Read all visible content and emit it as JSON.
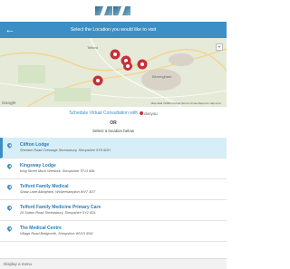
{
  "header": {
    "logo_icon": "four-triangle-logo"
  },
  "title_bar": {
    "back_icon": "arrow-left-icon",
    "title": "Select the Location you would like to visit"
  },
  "map": {
    "labels": [
      "Telford",
      "Birmingham",
      "Google"
    ],
    "zoom_label": "+",
    "footer": "Map data ©2023 Google  Terms of Use  Report a map error"
  },
  "virtual": {
    "link": "Schedule Virtual Consultation with",
    "brand": "docyou"
  },
  "or_label": "OR",
  "select_label": "Select a location below",
  "locations": [
    {
      "name": "Clifton Lodge",
      "address": "Shenton Road Cressage Shrewsbury, Shropshire SY5 6DH",
      "selected": true
    },
    {
      "name": "Kingsway Lodge",
      "address": "King Street Much Wenlock, Shropshire TF13 6BL",
      "selected": false
    },
    {
      "name": "Telford Family Medical",
      "address": "Shaw Lane Albrighton, Wolverhampton WV7 3DT",
      "selected": false
    },
    {
      "name": "Telford Family Medicine Primary Care",
      "address": "25 Sutton Road Shrewsbury, Shropshire SY2 6DL",
      "selected": false
    },
    {
      "name": "The Medical Centre",
      "address": "Village Road Bridgnorth, Shropshire WV15 6NG",
      "selected": false
    }
  ],
  "footer": {
    "menu_label": "Display a menu"
  },
  "colors": {
    "accent": "#3c8fc4",
    "selected_bg": "#d6eef7",
    "marker": "#c7303b"
  }
}
